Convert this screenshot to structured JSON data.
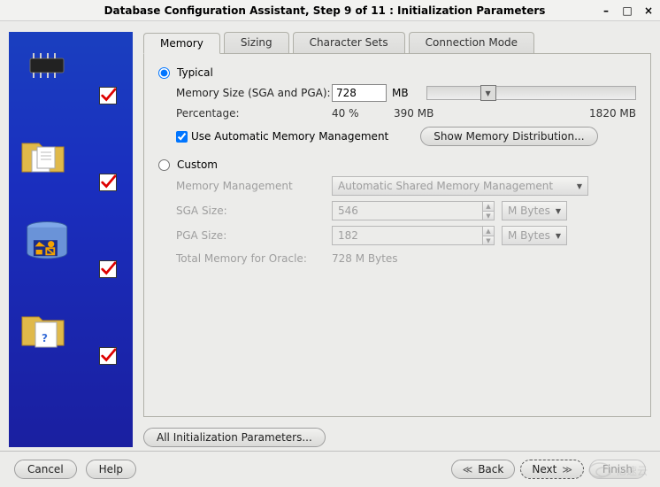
{
  "window": {
    "title": "Database Configuration Assistant, Step 9 of 11 : Initialization Parameters"
  },
  "tabs": {
    "memory": "Memory",
    "sizing": "Sizing",
    "charsets": "Character Sets",
    "connmode": "Connection Mode"
  },
  "typical": {
    "radio_label": "Typical",
    "memory_size_label": "Memory Size (SGA and PGA):",
    "memory_size_value": "728",
    "memory_size_unit": "MB",
    "percentage_label": "Percentage:",
    "percentage_value": "40 %",
    "mid_value": "390 MB",
    "max_value": "1820 MB",
    "use_amm_label": "Use Automatic Memory Management",
    "show_dist_label": "Show Memory Distribution..."
  },
  "custom": {
    "radio_label": "Custom",
    "mgmt_label": "Memory Management",
    "mgmt_value": "Automatic Shared Memory Management",
    "sga_label": "SGA Size:",
    "sga_value": "546",
    "pga_label": "PGA Size:",
    "pga_value": "182",
    "unit_option": "M Bytes",
    "total_label": "Total Memory for Oracle:",
    "total_value": "728 M Bytes"
  },
  "all_params_label": "All Initialization Parameters...",
  "footer": {
    "cancel": "Cancel",
    "help": "Help",
    "back": "Back",
    "next": "Next",
    "finish": "Finish"
  },
  "watermark": "亿速云"
}
